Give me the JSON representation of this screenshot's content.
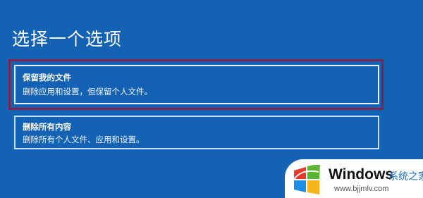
{
  "page": {
    "title": "选择一个选项"
  },
  "options": [
    {
      "title": "保留我的文件",
      "description": "删除应用和设置，但保留个人文件。"
    },
    {
      "title": "删除所有内容",
      "description": "删除所有个人文件、应用和设置。"
    }
  ],
  "watermark": {
    "brand": "Windows",
    "cn": "系统之家",
    "url": "www.bjjmlv.com"
  },
  "colors": {
    "background": "#1462b4",
    "highlight_frame": "#7e2349",
    "logo_red": "#e53b2c",
    "logo_green": "#5bb434",
    "logo_blue": "#1c8ee6",
    "logo_yellow": "#f7b51b"
  }
}
